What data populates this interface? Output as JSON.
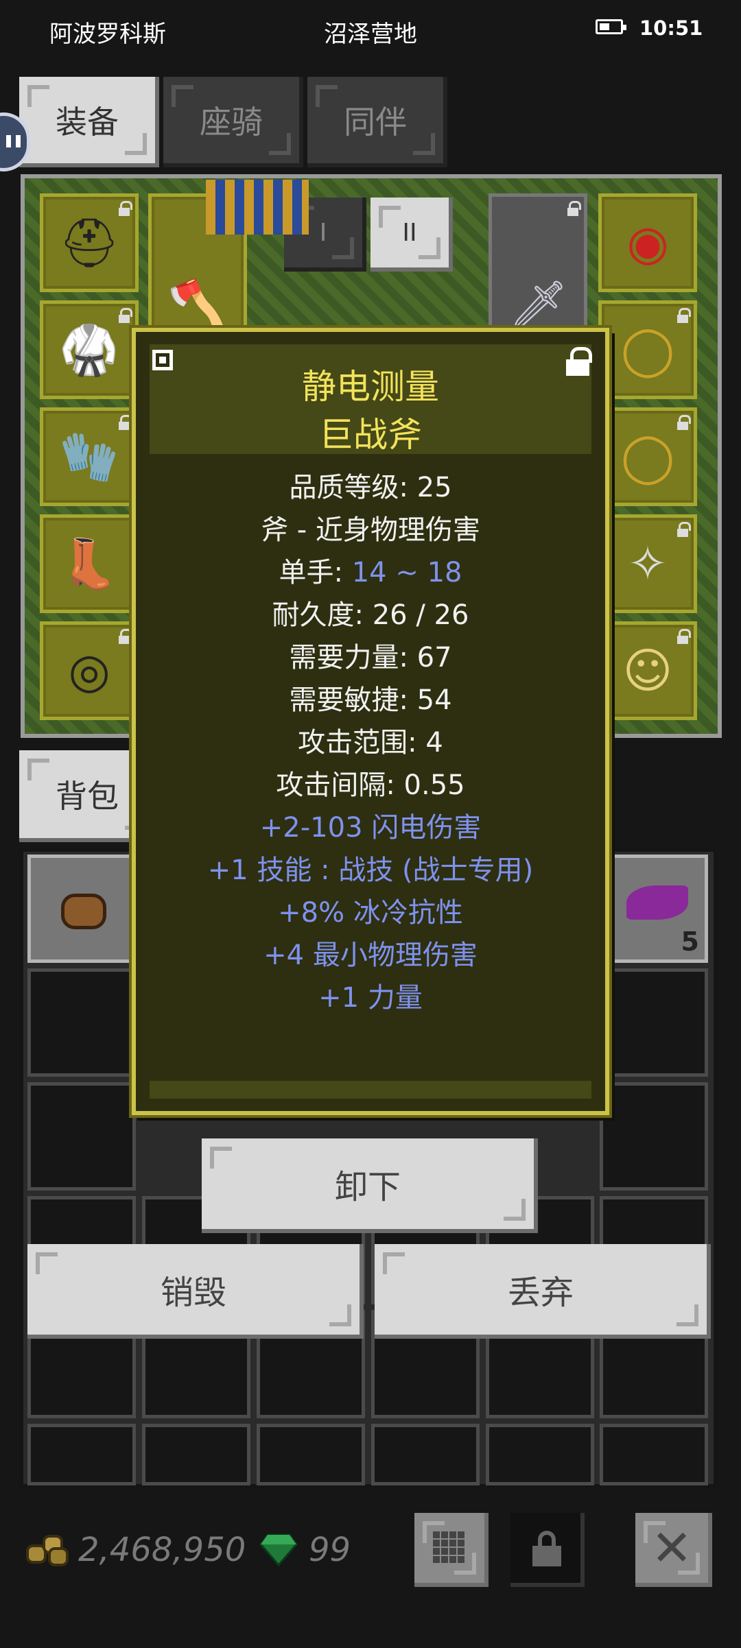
{
  "status_bar": {
    "location": "阿波罗科斯",
    "area": "沼泽营地",
    "time": "10:51"
  },
  "tabs": [
    {
      "label": "装备",
      "active": true
    },
    {
      "label": "座骑",
      "active": false
    },
    {
      "label": "同伴",
      "active": false
    }
  ],
  "weapon_sets": {
    "set1": "I",
    "set2": "II"
  },
  "bag_tab": {
    "label": "背包"
  },
  "bag_items": {
    "stack_count": "5"
  },
  "tooltip": {
    "item_name": "静电测量",
    "base_type": "巨战斧",
    "quality_level": "品质等级: 25",
    "category": "斧 - 近身物理伤害",
    "damage_label": "单手: ",
    "damage_value": "14 ~ 18",
    "durability": "耐久度: 26 / 26",
    "req_str": "需要力量: 67",
    "req_dex": "需要敏捷: 54",
    "attack_range": "攻击范围: 4",
    "attack_interval": "攻击间隔: 0.55",
    "mods": [
      "+2-103 闪电伤害",
      "+1 技能 : 战技 (战士专用)",
      "+8% 冰冷抗性",
      "+4 最小物理伤害",
      "+1 力量"
    ]
  },
  "actions": {
    "unequip": "卸下",
    "destroy": "销毁",
    "discard": "丢弃"
  },
  "currency": {
    "gold": "2,468,950",
    "gems": "99"
  },
  "colors": {
    "item_name": "#f2e35b",
    "magic_mod": "#7f92ee",
    "tooltip_border": "#cbc34a"
  }
}
